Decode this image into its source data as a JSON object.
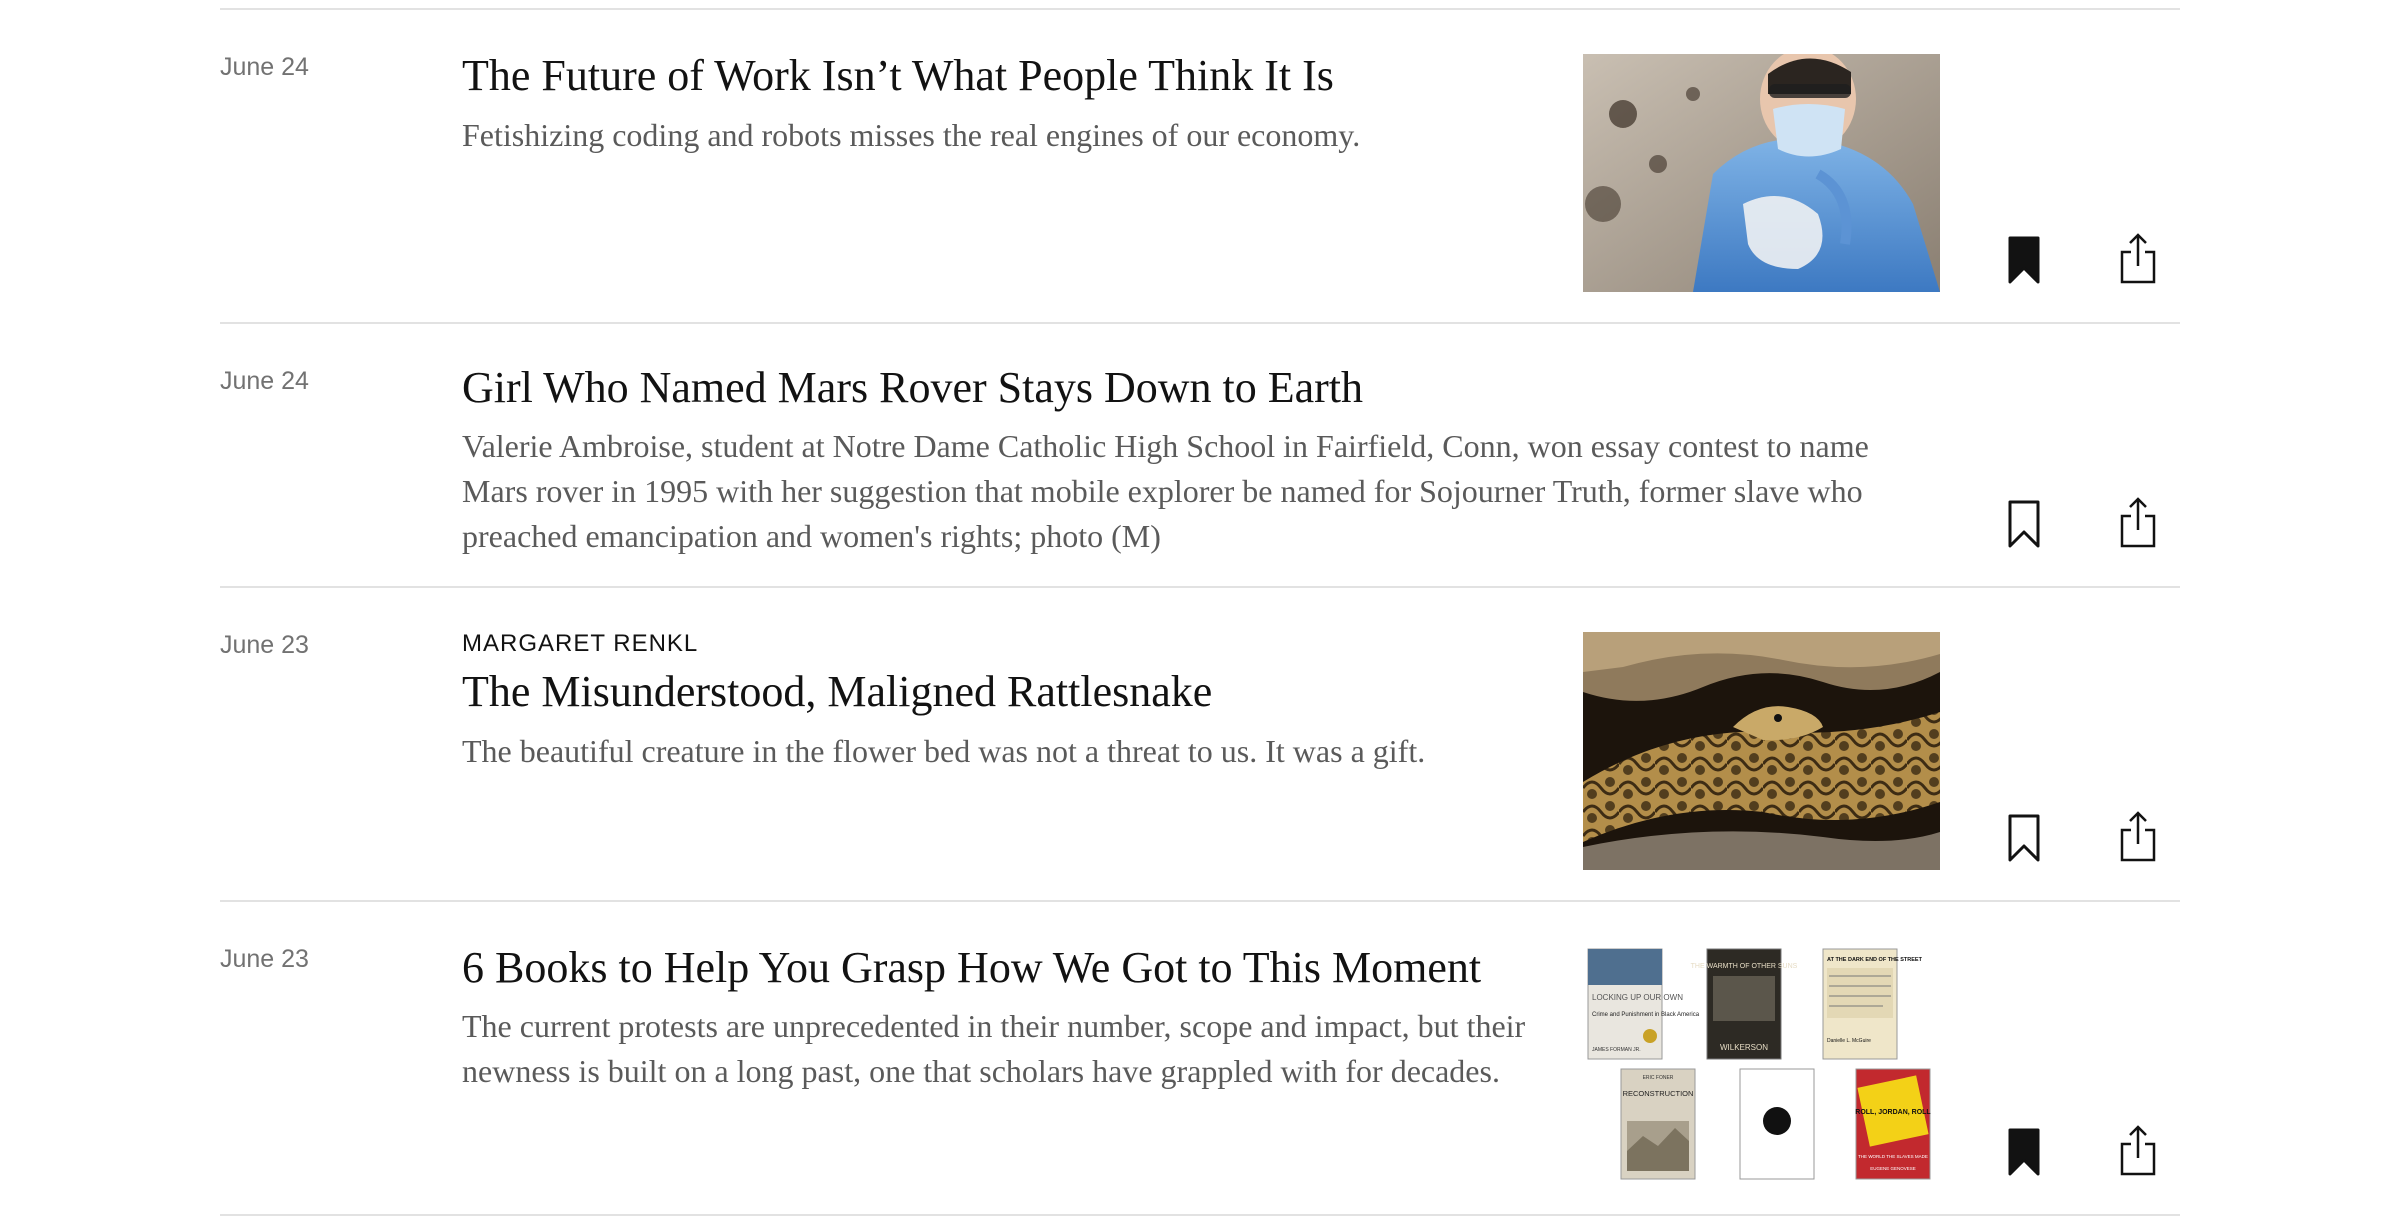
{
  "articles": [
    {
      "date": "June 24",
      "kicker": "",
      "headline": "The Future of Work Isn’t What People Think It Is",
      "summary": "Fetishizing coding and robots misses the real engines of our economy.",
      "image": "healthcare-worker-in-ppe-photo",
      "saved": true
    },
    {
      "date": "June 24",
      "kicker": "",
      "headline": "Girl Who Named Mars Rover Stays Down to Earth",
      "summary": "Valerie Ambroise, student at Notre Dame Catholic High School in Fairfield, Conn, won essay contest to name Mars rover in 1995 with her suggestion that mobile explorer be named for Sojourner Truth, former slave who preached emancipation and women's rights; photo (M)",
      "image": "",
      "saved": false
    },
    {
      "date": "June 23",
      "kicker": "MARGARET RENKL",
      "headline": "The Misunderstood, Maligned Rattlesnake",
      "summary": "The beautiful creature in the flower bed was not a threat to us. It was a gift.",
      "image": "rattlesnake-photo",
      "saved": false
    },
    {
      "date": "June 23",
      "kicker": "",
      "headline": "6 Books to Help You Grasp How We Got to This Moment",
      "summary": "The current protests are unprecedented in their number, scope and impact, but their newness is built on a long past, one that scholars have grappled with for decades.",
      "image": "book-covers-collage",
      "saved": true,
      "books": [
        {
          "title": "LOCKING UP OUR OWN",
          "subtitle": "Crime and Punishment in Black America",
          "author": "JAMES FORMAN JR."
        },
        {
          "title": "THE WARMTH OF OTHER SUNS",
          "subtitle": "",
          "author": "WILKERSON"
        },
        {
          "title": "AT THE DARK END OF THE STREET",
          "subtitle": "Black Women, Rape, and Resistance—a New History of the Civil Rights Movement from Rosa Parks to the Rise of Black Power",
          "author": "Danielle L. McGuire"
        },
        {
          "title": "RECONSTRUCTION",
          "subtitle": "AMERICA'S UNFINISHED REVOLUTION 1863–1877",
          "author": "ERIC FONER"
        },
        {
          "title": "",
          "subtitle": "",
          "author": ""
        },
        {
          "title": "ROLL, JORDAN, ROLL",
          "subtitle": "THE WORLD THE SLAVES MADE",
          "author": "EUGENE GENOVESE"
        }
      ]
    }
  ],
  "icons": {
    "bookmark": "bookmark-icon",
    "share": "share-icon"
  },
  "colors": {
    "text": "#121212",
    "summary": "#5a5a5a",
    "date": "#727272",
    "divider": "#e2e2e2"
  }
}
